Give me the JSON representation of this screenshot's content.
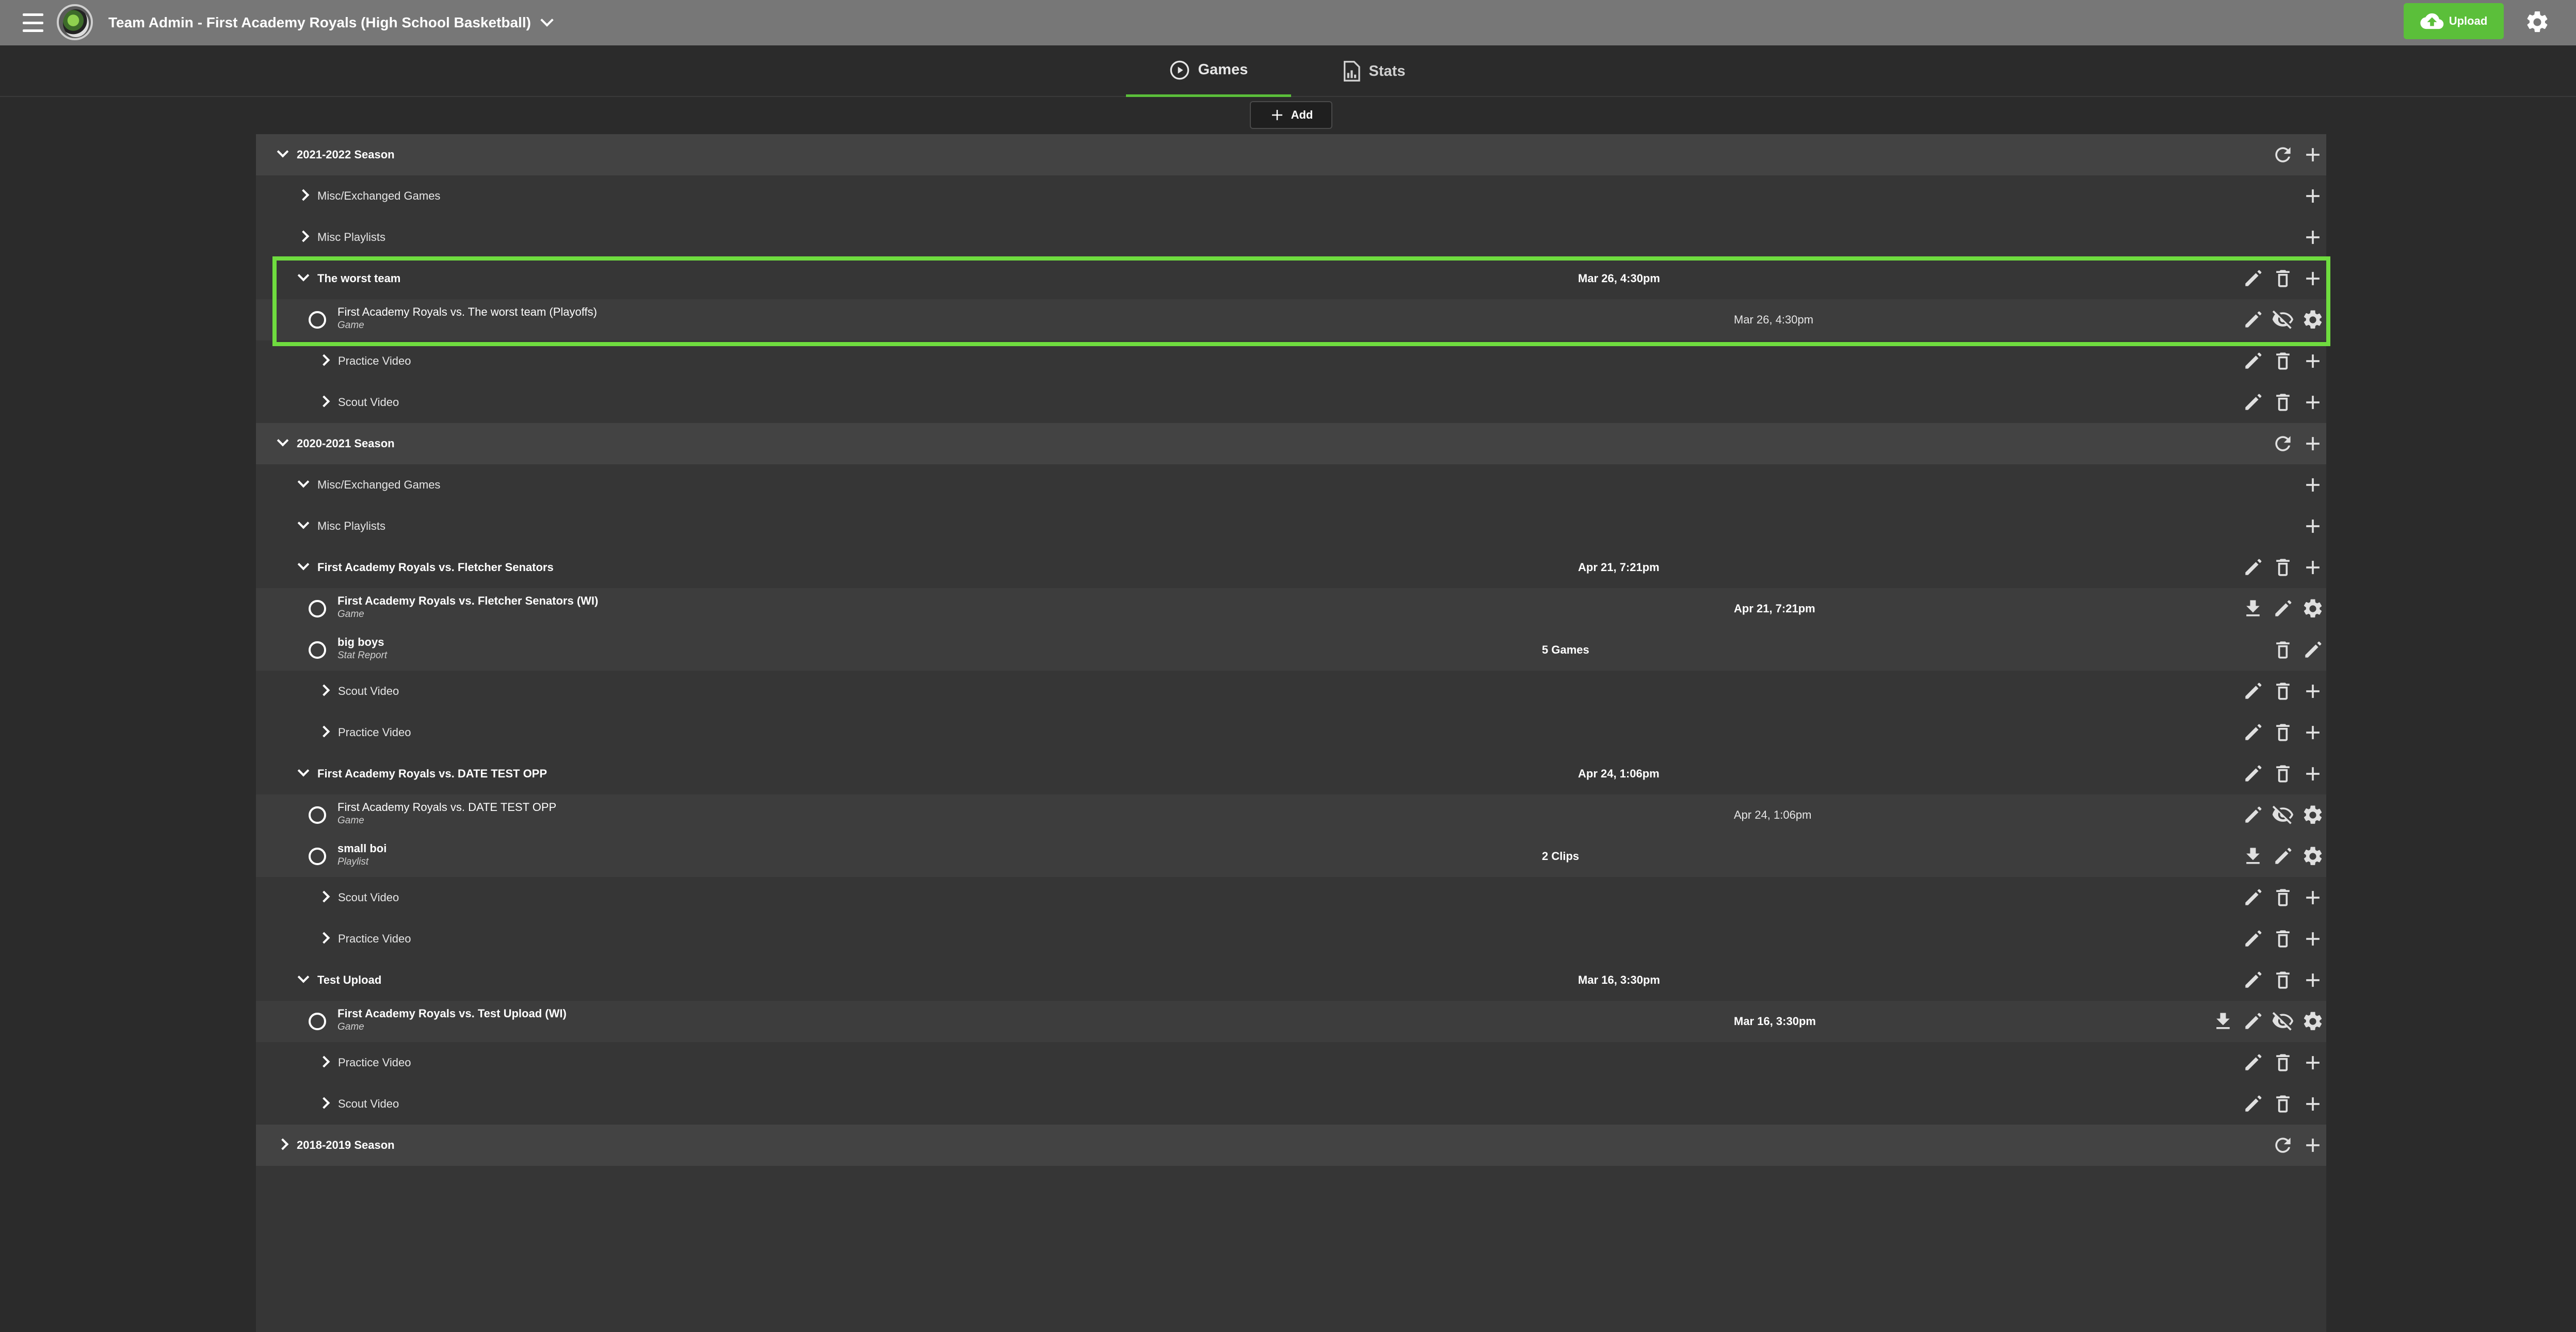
{
  "header": {
    "title": "Team Admin - First Academy Royals (High School Basketball)",
    "upload_label": "Upload"
  },
  "tabs": [
    {
      "label": "Games",
      "active": true
    },
    {
      "label": "Stats",
      "active": false
    }
  ],
  "toolbar": {
    "add_label": "Add"
  },
  "accent_color": "#5bbf3a",
  "highlight_color": "#6fdc3f",
  "rows": [
    {
      "kind": "season",
      "expanded": true,
      "label": "2021-2022 Season",
      "date": "",
      "count": "",
      "actions": [
        "refresh-icon",
        "plus-icon"
      ]
    },
    {
      "kind": "group",
      "expanded": false,
      "label": "Misc/Exchanged Games",
      "date": "",
      "count": "",
      "actions": [
        "plus-icon"
      ]
    },
    {
      "kind": "group",
      "expanded": false,
      "label": "Misc Playlists",
      "date": "",
      "count": "",
      "actions": [
        "plus-icon"
      ]
    },
    {
      "kind": "group",
      "expanded": true,
      "label": "The worst team",
      "date": "Mar 26, 4:30pm",
      "count": "",
      "actions": [
        "pencil-icon",
        "trash-icon",
        "plus-icon"
      ]
    },
    {
      "kind": "item",
      "bold": false,
      "label": "First Academy Royals vs. The worst team (Playoffs)",
      "sub": "Game",
      "date": "Mar 26, 4:30pm",
      "count": "",
      "actions": [
        "pencil-icon",
        "eye-off-icon",
        "gear-icon"
      ]
    },
    {
      "kind": "sub",
      "expanded": false,
      "label": "Practice Video",
      "date": "",
      "count": "",
      "actions": [
        "pencil-icon",
        "trash-icon",
        "plus-icon"
      ]
    },
    {
      "kind": "sub",
      "expanded": false,
      "label": "Scout Video",
      "date": "",
      "count": "",
      "actions": [
        "pencil-icon",
        "trash-icon",
        "plus-icon"
      ]
    },
    {
      "kind": "season",
      "expanded": true,
      "label": "2020-2021 Season",
      "date": "",
      "count": "",
      "actions": [
        "refresh-icon",
        "plus-icon"
      ]
    },
    {
      "kind": "group",
      "expanded": true,
      "label": "Misc/Exchanged Games",
      "date": "",
      "count": "",
      "actions": [
        "plus-icon"
      ]
    },
    {
      "kind": "group",
      "expanded": true,
      "label": "Misc Playlists",
      "date": "",
      "count": "",
      "actions": [
        "plus-icon"
      ]
    },
    {
      "kind": "group",
      "expanded": true,
      "label": "First Academy Royals vs. Fletcher Senators",
      "date": "Apr 21, 7:21pm",
      "count": "",
      "actions": [
        "pencil-icon",
        "trash-icon",
        "plus-icon"
      ]
    },
    {
      "kind": "item",
      "bold": true,
      "label": "First Academy Royals vs. Fletcher Senators (WI)",
      "sub": "Game",
      "date": "Apr 21, 7:21pm",
      "count": "",
      "actions": [
        "download-icon",
        "pencil-icon",
        "gear-icon"
      ]
    },
    {
      "kind": "item",
      "bold": true,
      "label": "big boys",
      "sub": "Stat Report",
      "date": "",
      "count": "5 Games",
      "actions": [
        "trash-icon",
        "pencil-icon"
      ]
    },
    {
      "kind": "sub",
      "expanded": false,
      "label": "Scout Video",
      "date": "",
      "count": "",
      "actions": [
        "pencil-icon",
        "trash-icon",
        "plus-icon"
      ]
    },
    {
      "kind": "sub",
      "expanded": false,
      "label": "Practice Video",
      "date": "",
      "count": "",
      "actions": [
        "pencil-icon",
        "trash-icon",
        "plus-icon"
      ]
    },
    {
      "kind": "group",
      "expanded": true,
      "label": "First Academy Royals vs. DATE TEST OPP",
      "date": "Apr 24, 1:06pm",
      "count": "",
      "actions": [
        "pencil-icon",
        "trash-icon",
        "plus-icon"
      ]
    },
    {
      "kind": "item",
      "bold": false,
      "label": "First Academy Royals vs. DATE TEST OPP",
      "sub": "Game",
      "date": "Apr 24, 1:06pm",
      "count": "",
      "actions": [
        "pencil-icon",
        "eye-off-icon",
        "gear-icon"
      ]
    },
    {
      "kind": "item",
      "bold": true,
      "label": "small boi",
      "sub": "Playlist",
      "date": "",
      "count": "2 Clips",
      "actions": [
        "download-icon",
        "pencil-icon",
        "gear-icon"
      ]
    },
    {
      "kind": "sub",
      "expanded": false,
      "label": "Scout Video",
      "date": "",
      "count": "",
      "actions": [
        "pencil-icon",
        "trash-icon",
        "plus-icon"
      ]
    },
    {
      "kind": "sub",
      "expanded": false,
      "label": "Practice Video",
      "date": "",
      "count": "",
      "actions": [
        "pencil-icon",
        "trash-icon",
        "plus-icon"
      ]
    },
    {
      "kind": "group",
      "expanded": true,
      "label": "Test Upload",
      "date": "Mar 16, 3:30pm",
      "count": "",
      "actions": [
        "pencil-icon",
        "trash-icon",
        "plus-icon"
      ]
    },
    {
      "kind": "item",
      "bold": true,
      "label": "First Academy Royals vs. Test Upload (WI)",
      "sub": "Game",
      "date": "Mar 16, 3:30pm",
      "count": "",
      "actions": [
        "download-icon",
        "pencil-icon",
        "eye-off-icon",
        "gear-icon"
      ]
    },
    {
      "kind": "sub",
      "expanded": false,
      "label": "Practice Video",
      "date": "",
      "count": "",
      "actions": [
        "pencil-icon",
        "trash-icon",
        "plus-icon"
      ]
    },
    {
      "kind": "sub",
      "expanded": false,
      "label": "Scout Video",
      "date": "",
      "count": "",
      "actions": [
        "pencil-icon",
        "trash-icon",
        "plus-icon"
      ]
    },
    {
      "kind": "season",
      "expanded": false,
      "label": "2018-2019 Season",
      "date": "",
      "count": "",
      "actions": [
        "refresh-icon",
        "plus-icon"
      ]
    }
  ]
}
